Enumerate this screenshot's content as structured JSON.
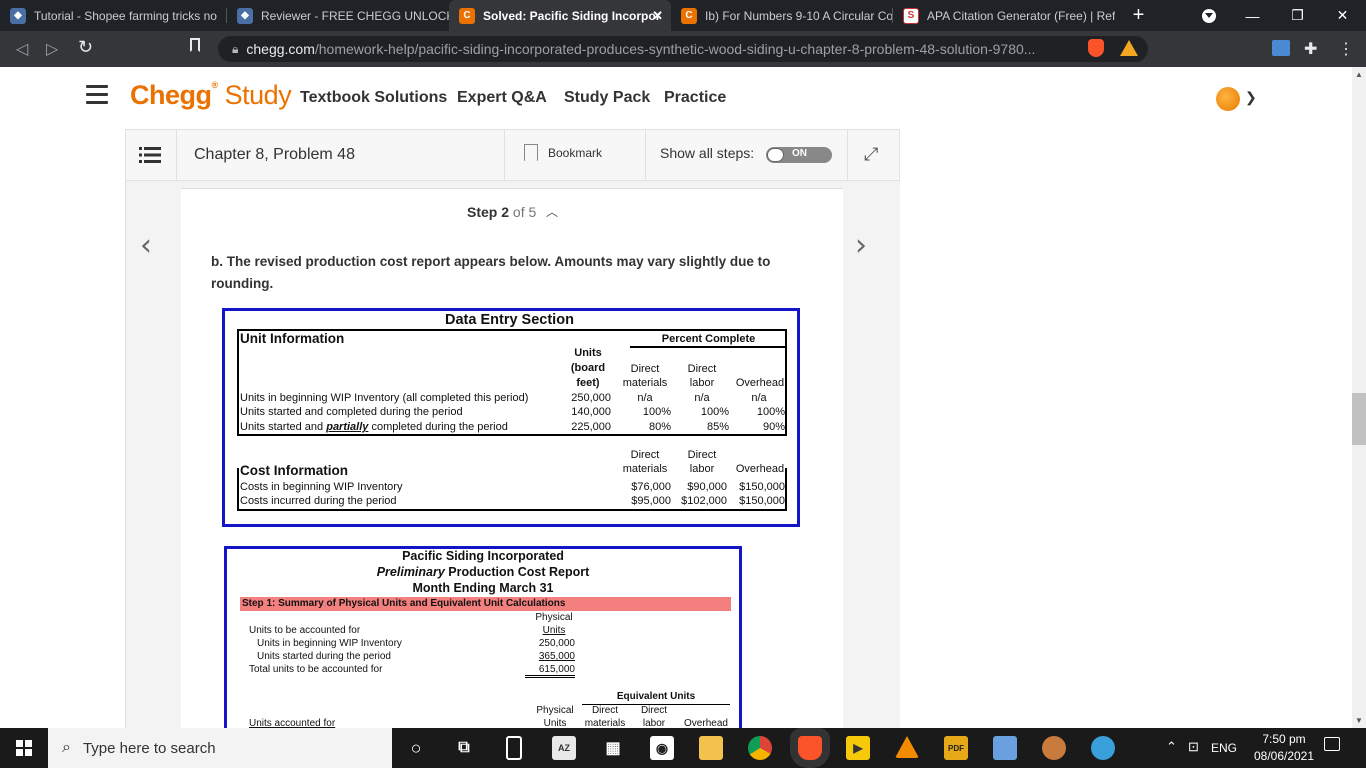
{
  "browser": {
    "tabs": [
      {
        "label": "Tutorial - Shopee farming tricks no",
        "icon": "shield-fav-icon"
      },
      {
        "label": "Reviewer - FREE CHEGG UNLOCKS",
        "icon": "shield-fav-icon"
      },
      {
        "label": "Solved: Pacific Siding Incorpor",
        "icon": "chegg-fav-icon",
        "active": true
      },
      {
        "label": "Ib) For Numbers 9-10 A Circular Co",
        "icon": "chegg-fav-icon"
      },
      {
        "label": "APA Citation Generator (Free) | Ref",
        "icon": "scribbr-fav-icon"
      }
    ],
    "url_host": "chegg.com",
    "url_path": "/homework-help/pacific-siding-incorporated-produces-synthetic-wood-siding-u-chapter-8-problem-48-solution-9780..."
  },
  "header": {
    "logo_chegg": "Chegg",
    "logo_study": "Study",
    "nav": [
      "Textbook Solutions",
      "Expert Q&A",
      "Study Pack",
      "Practice"
    ]
  },
  "toolbar": {
    "title": "Chapter 8, Problem 48",
    "bookmark": "Bookmark",
    "show_steps": "Show all steps:",
    "toggle": "ON"
  },
  "step": {
    "label": "Step 2",
    "of": "of 5",
    "text": "b. The revised production cost report appears below. Amounts may vary slightly due to rounding."
  },
  "sheet1": {
    "title": "Data Entry Section",
    "unit_info": "Unit Information",
    "percent_complete": "Percent Complete",
    "units_hdr": [
      "Units",
      "(board",
      "feet)"
    ],
    "dm_hdr": [
      "Direct",
      "materials"
    ],
    "dl_hdr": [
      "Direct",
      "labor"
    ],
    "oh_hdr": "Overhead",
    "rows": [
      {
        "label": "Units in beginning WIP Inventory (all completed this period)",
        "units": "250,000",
        "dm": "n/a",
        "dl": "n/a",
        "oh": "n/a"
      },
      {
        "label": "Units started and completed during the period",
        "units": "140,000",
        "dm": "100%",
        "dl": "100%",
        "oh": "100%"
      },
      {
        "label_a": "Units started and ",
        "label_b": "partially",
        "label_c": " completed during the period",
        "units": "225,000",
        "dm": "80%",
        "dl": "85%",
        "oh": "90%"
      }
    ],
    "cost_info": "Cost Information",
    "cost_rows": [
      {
        "label": "Costs in beginning WIP Inventory",
        "dm": "$76,000",
        "dl": "$90,000",
        "oh": "$150,000"
      },
      {
        "label": "Costs incurred during the period",
        "dm": "$95,000",
        "dl": "$102,000",
        "oh": "$150,000"
      }
    ]
  },
  "sheet2": {
    "company": "Pacific Siding Incorporated",
    "report_a": "Preliminary",
    "report_b": " Production Cost Report",
    "period": "Month Ending March 31",
    "step1": "Step 1:  Summary of Physical Units and Equivalent Unit Calculations",
    "physical": "Physical",
    "units": "Units",
    "to_be_accounted": "Units to be accounted for",
    "beg_wip": "Units in beginning WIP Inventory",
    "started": "Units started during the period",
    "total": "Total units to be accounted for",
    "beg_wip_val": "250,000",
    "started_val": "365,000",
    "total_val": "615,000",
    "equiv_units": "Equivalent Units",
    "direct": "Direct",
    "materials": "materials",
    "labor": "labor",
    "overhead": "Overhead",
    "accounted_for": "Units accounted for"
  },
  "taskbar": {
    "search_placeholder": "Type here to search",
    "lang": "ENG",
    "time": "7:50 pm",
    "date": "08/06/2021"
  }
}
